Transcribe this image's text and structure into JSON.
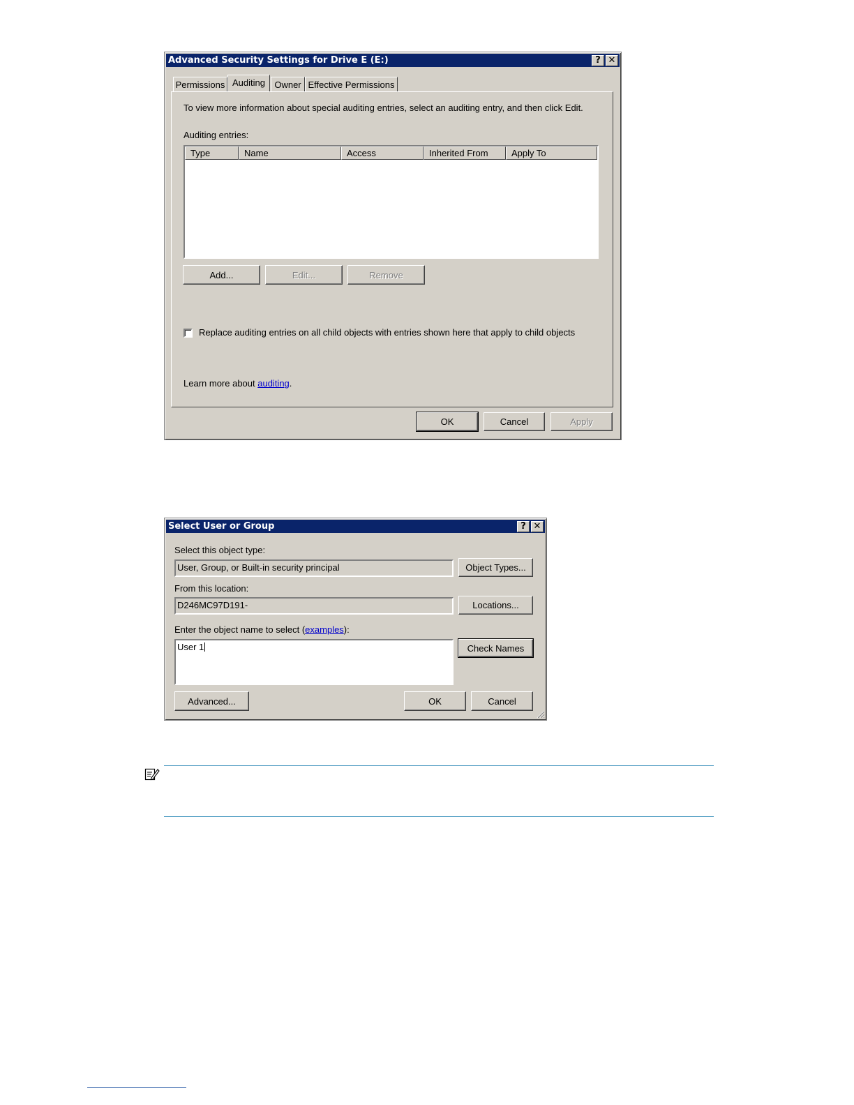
{
  "advanced_dialog": {
    "title": "Advanced Security Settings for Drive E (E:)",
    "help_button": "?",
    "close_button": "✕",
    "tabs": [
      {
        "label": "Permissions"
      },
      {
        "label": "Auditing"
      },
      {
        "label": "Owner"
      },
      {
        "label": "Effective Permissions"
      }
    ],
    "active_tab": "Auditing",
    "instructions": "To view more information about special auditing entries, select an auditing entry, and then click Edit.",
    "entries_label": "Auditing entries:",
    "columns": [
      "Type",
      "Name",
      "Access",
      "Inherited From",
      "Apply To"
    ],
    "rows": [],
    "add_button": "Add...",
    "edit_button": "Edit...",
    "remove_button": "Remove",
    "replace_checkbox_label": "Replace auditing entries on all child objects with entries shown here that apply to child objects",
    "replace_checked": false,
    "learn_more_prefix": "Learn more about ",
    "learn_more_link": "auditing",
    "learn_more_suffix": ".",
    "ok_button": "OK",
    "cancel_button": "Cancel",
    "apply_button": "Apply"
  },
  "select_dialog": {
    "title": "Select User or Group",
    "help_button": "?",
    "close_button": "✕",
    "object_type_label": "Select this object type:",
    "object_type_value": "User, Group, or Built-in security principal",
    "object_types_button": "Object Types...",
    "location_label": "From this location:",
    "location_value": "D246MC97D191-",
    "locations_button": "Locations...",
    "object_name_label_prefix": "Enter the object name to select (",
    "object_name_label_link": "examples",
    "object_name_label_suffix": "):",
    "object_name_value": "User 1",
    "check_names_button": "Check Names",
    "advanced_button": "Advanced...",
    "ok_button": "OK",
    "cancel_button": "Cancel"
  },
  "note": {
    "icon": "note-icon"
  }
}
